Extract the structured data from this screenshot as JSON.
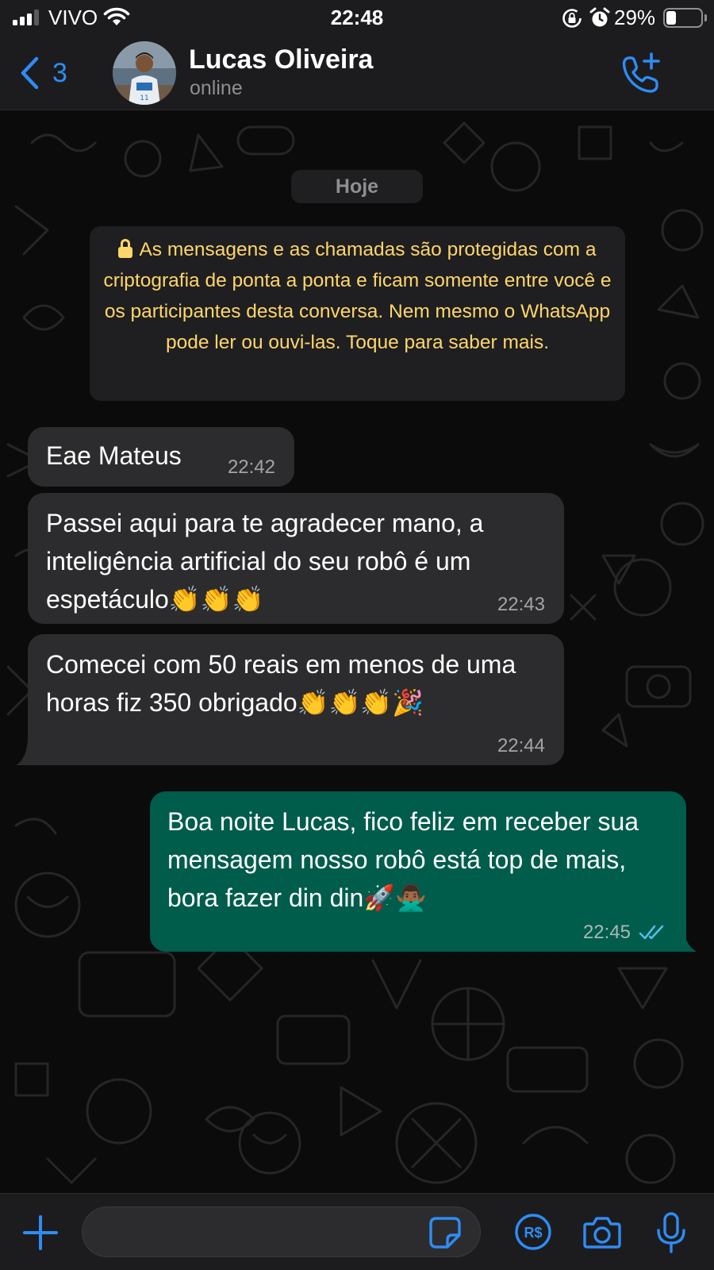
{
  "status_bar": {
    "carrier": "VIVO",
    "time": "22:48",
    "battery_percent": "29%",
    "battery_level": 0.29
  },
  "header": {
    "back_count": "3",
    "contact_name": "Lucas Oliveira",
    "contact_status": "online",
    "icons": [
      "chevron-left-icon",
      "avatar",
      "add-call-icon"
    ]
  },
  "chat": {
    "date_label": "Hoje",
    "encryption_notice": "As mensagens e as chamadas são protegidas com a criptografia de ponta a ponta e ficam somente entre você e os participantes desta conversa. Nem mesmo o WhatsApp pode ler ou ouvi-las. Toque para saber mais.",
    "messages": [
      {
        "direction": "incoming",
        "text": "Eae Mateus",
        "time": "22:42"
      },
      {
        "direction": "incoming",
        "text": "Passei aqui para te agradecer mano, a inteligência artificial do seu robô é um espetáculo👏👏👏",
        "time": "22:43"
      },
      {
        "direction": "incoming",
        "text": "Comecei com 50 reais em menos de uma horas fiz 350 obrigado👏👏👏🎉",
        "time": "22:44"
      },
      {
        "direction": "outgoing",
        "text": "Boa noite Lucas, fico feliz em receber sua mensagem nosso robô está top de mais, bora fazer din din🚀🙅🏾‍♂️",
        "time": "22:45",
        "status": "read"
      }
    ]
  },
  "input_bar": {
    "message_value": "",
    "icons": [
      "plus-icon",
      "sticker-icon",
      "payment-icon",
      "camera-icon",
      "microphone-icon"
    ]
  },
  "colors": {
    "accent": "#2f8cf5",
    "incoming_bubble": "#2c2c2e",
    "outgoing_bubble": "#005c4b",
    "notice_text": "#ffd66b",
    "background": "#0b0b0b"
  }
}
